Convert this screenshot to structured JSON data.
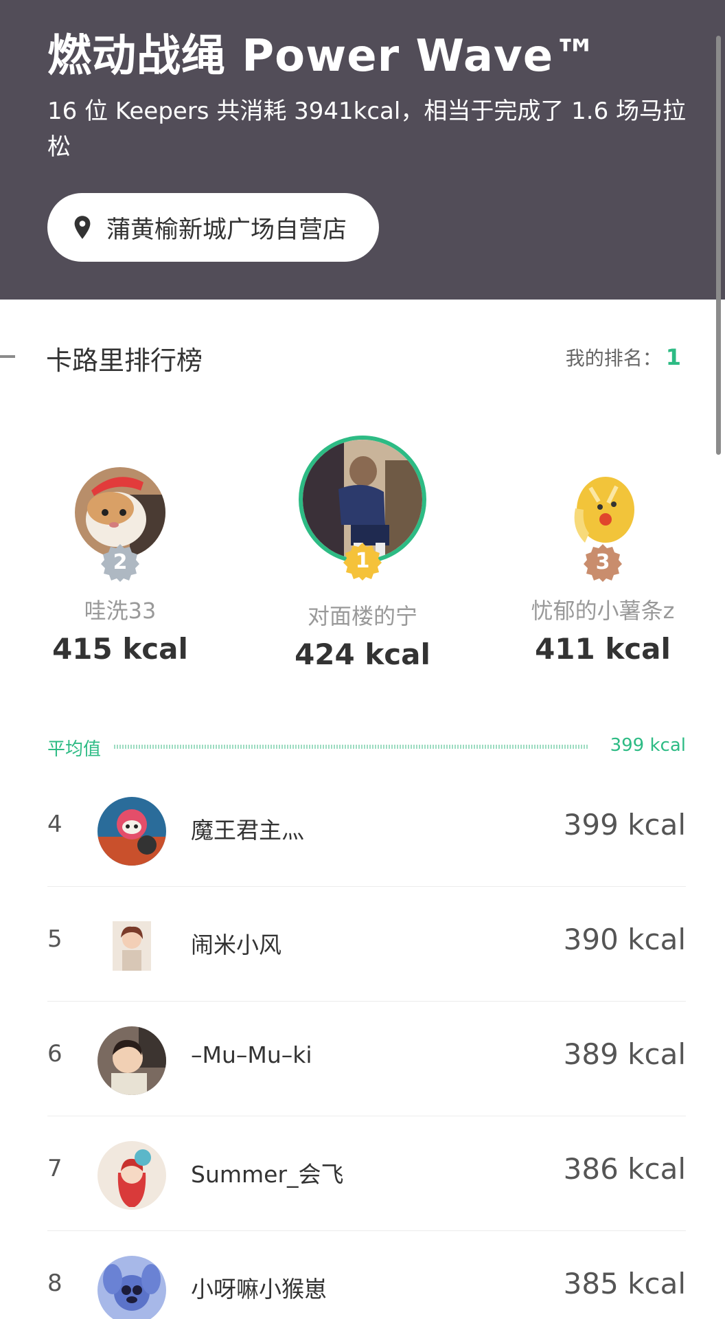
{
  "header": {
    "title": "燃动战绳 Power Wave™",
    "subtitle": "16 位 Keepers 共消耗 3941kcal，相当于完成了 1.6 场马拉松",
    "location": "蒲黄榆新城广场自营店"
  },
  "leaderboard": {
    "title": "卡路里排行榜",
    "my_rank_label": "我的排名：",
    "my_rank_value": "1",
    "podium": [
      {
        "rank": "2",
        "name": "哇洗33",
        "kcal": "415 kcal",
        "badge_color": "#aeb8c2"
      },
      {
        "rank": "1",
        "name": "对面楼的宁",
        "kcal": "424 kcal",
        "badge_color": "#f5c23a"
      },
      {
        "rank": "3",
        "name": "忧郁的小薯条z",
        "kcal": "411 kcal",
        "badge_color": "#c98d6d"
      }
    ],
    "average": {
      "label": "平均值",
      "value": "399 kcal"
    },
    "rows": [
      {
        "rank": "4",
        "name": "魔王君主灬",
        "kcal": "399 kcal"
      },
      {
        "rank": "5",
        "name": "闹米小风",
        "kcal": "390 kcal"
      },
      {
        "rank": "6",
        "name": "–Mu–Mu–ki",
        "kcal": "389 kcal"
      },
      {
        "rank": "7",
        "name": "Summer_会飞",
        "kcal": "386 kcal"
      },
      {
        "rank": "8",
        "name": "小呀嘛小猴崽",
        "kcal": "385 kcal"
      }
    ]
  },
  "colors": {
    "header_bg": "#524d58",
    "accent": "#2dbb84",
    "winner_ring": "#2dbb84"
  }
}
